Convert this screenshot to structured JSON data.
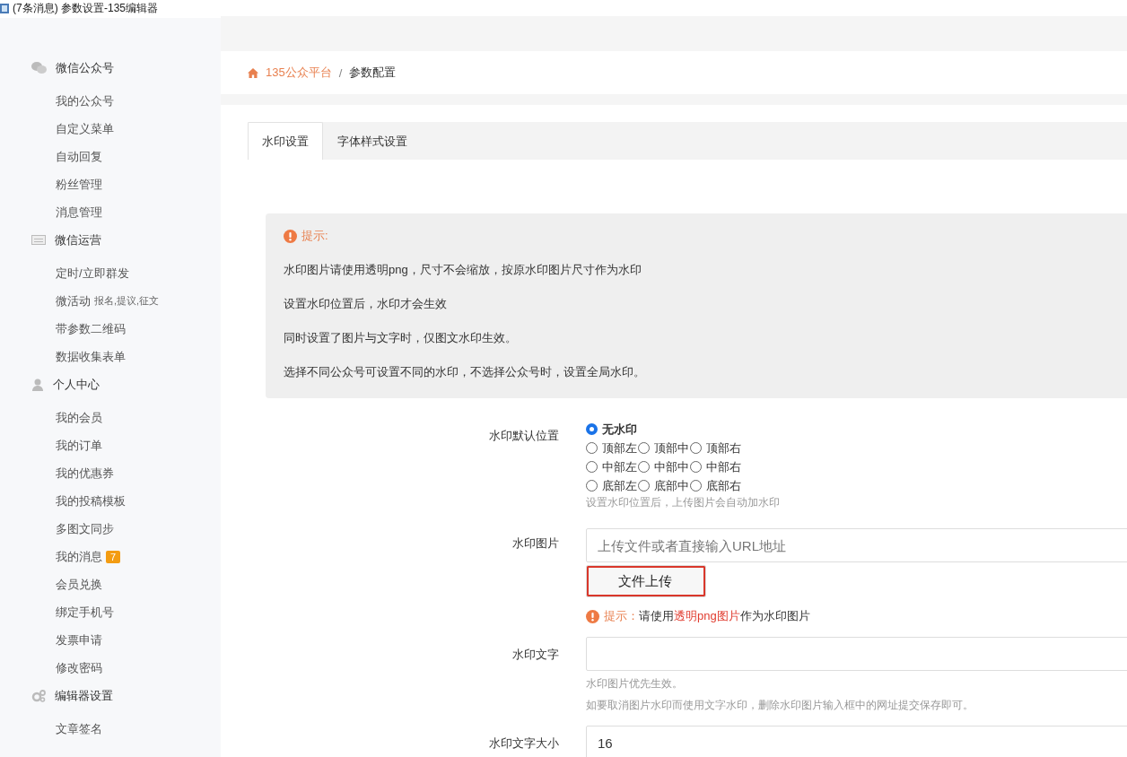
{
  "window": {
    "title": "(7条消息) 参数设置-135编辑器"
  },
  "sidebar": [
    {
      "title": "微信公众号",
      "kind": "chat",
      "items": [
        {
          "label": "我的公众号"
        },
        {
          "label": "自定义菜单"
        },
        {
          "label": "自动回复"
        },
        {
          "label": "粉丝管理"
        },
        {
          "label": "消息管理"
        }
      ]
    },
    {
      "title": "微信运营",
      "kind": "card",
      "items": [
        {
          "label": "定时/立即群发"
        },
        {
          "label": "微活动",
          "note": "报名,提议,征文"
        },
        {
          "label": "带参数二维码"
        },
        {
          "label": "数据收集表单"
        }
      ]
    },
    {
      "title": "个人中心",
      "kind": "user",
      "items": [
        {
          "label": "我的会员"
        },
        {
          "label": "我的订单"
        },
        {
          "label": "我的优惠券"
        },
        {
          "label": "我的投稿模板"
        },
        {
          "label": "多图文同步"
        },
        {
          "label": "我的消息",
          "badge": "7"
        },
        {
          "label": "会员兑换"
        },
        {
          "label": "绑定手机号"
        },
        {
          "label": "发票申请"
        },
        {
          "label": "修改密码"
        }
      ]
    },
    {
      "title": "编辑器设置",
      "kind": "gears",
      "items": [
        {
          "label": "文章签名"
        }
      ]
    }
  ],
  "breadcrumb": {
    "home": "135公众平台",
    "separator": "/",
    "current": "参数配置"
  },
  "tabs": [
    {
      "label": "水印设置",
      "selected": true
    },
    {
      "label": "字体样式设置",
      "selected": false
    }
  ],
  "notice": {
    "title": "提示:",
    "lines": [
      "水印图片请使用透明png，尺寸不会缩放，按原水印图片尺寸作为水印",
      "设置水印位置后，水印才会生效",
      "同时设置了图片与文字时，仅图文水印生效。",
      "选择不同公众号可设置不同的水印，不选择公众号时，设置全局水印。"
    ]
  },
  "form": {
    "position": {
      "label": "水印默认位置",
      "rows": [
        [
          {
            "label": "无水印",
            "selected": true
          }
        ],
        [
          {
            "label": "顶部左",
            "selected": false
          },
          {
            "label": "顶部中",
            "selected": false
          },
          {
            "label": "顶部右",
            "selected": false
          }
        ],
        [
          {
            "label": "中部左",
            "selected": false
          },
          {
            "label": "中部中",
            "selected": false
          },
          {
            "label": "中部右",
            "selected": false
          }
        ],
        [
          {
            "label": "底部左",
            "selected": false
          },
          {
            "label": "底部中",
            "selected": false
          },
          {
            "label": "底部右",
            "selected": false
          }
        ]
      ],
      "help": "设置水印位置后，上传图片会自动加水印"
    },
    "image": {
      "label": "水印图片",
      "placeholder": "上传文件或者直接输入URL地址",
      "button": "文件上传",
      "hint": [
        {
          "text": "提示：",
          "kind": "title"
        },
        {
          "text": "请使用",
          "kind": "plain"
        },
        {
          "text": "透明png图片",
          "kind": "accent"
        },
        {
          "text": "作为水印图片",
          "kind": "plain"
        }
      ]
    },
    "text": {
      "label": "水印文字",
      "help": [
        "水印图片优先生效。",
        "如要取消图片水印而使用文字水印，删除水印图片输入框中的网址提交保存即可。"
      ]
    },
    "size": {
      "label": "水印文字大小",
      "value": "16"
    }
  }
}
